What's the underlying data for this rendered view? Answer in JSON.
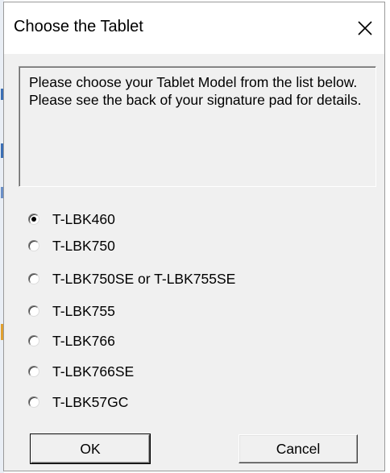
{
  "window": {
    "title": "Choose the Tablet",
    "close_icon": "close-icon"
  },
  "description": "Please choose your Tablet Model from the list below. Please see the back of your signature pad for details.",
  "models": [
    {
      "label": "T-LBK460",
      "checked": true
    },
    {
      "label": "T-LBK750",
      "checked": false
    },
    {
      "label": "T-LBK750SE or T-LBK755SE",
      "checked": false
    },
    {
      "label": "T-LBK755",
      "checked": false
    },
    {
      "label": "T-LBK766",
      "checked": false
    },
    {
      "label": "T-LBK766SE",
      "checked": false
    },
    {
      "label": "T-LBK57GC",
      "checked": false
    }
  ],
  "buttons": {
    "ok_label": "OK",
    "cancel_label": "Cancel"
  },
  "colors": {
    "dialog_bg": "#f0f0f0",
    "titlebar_bg": "#ffffff",
    "border": "#9a9a9a"
  }
}
